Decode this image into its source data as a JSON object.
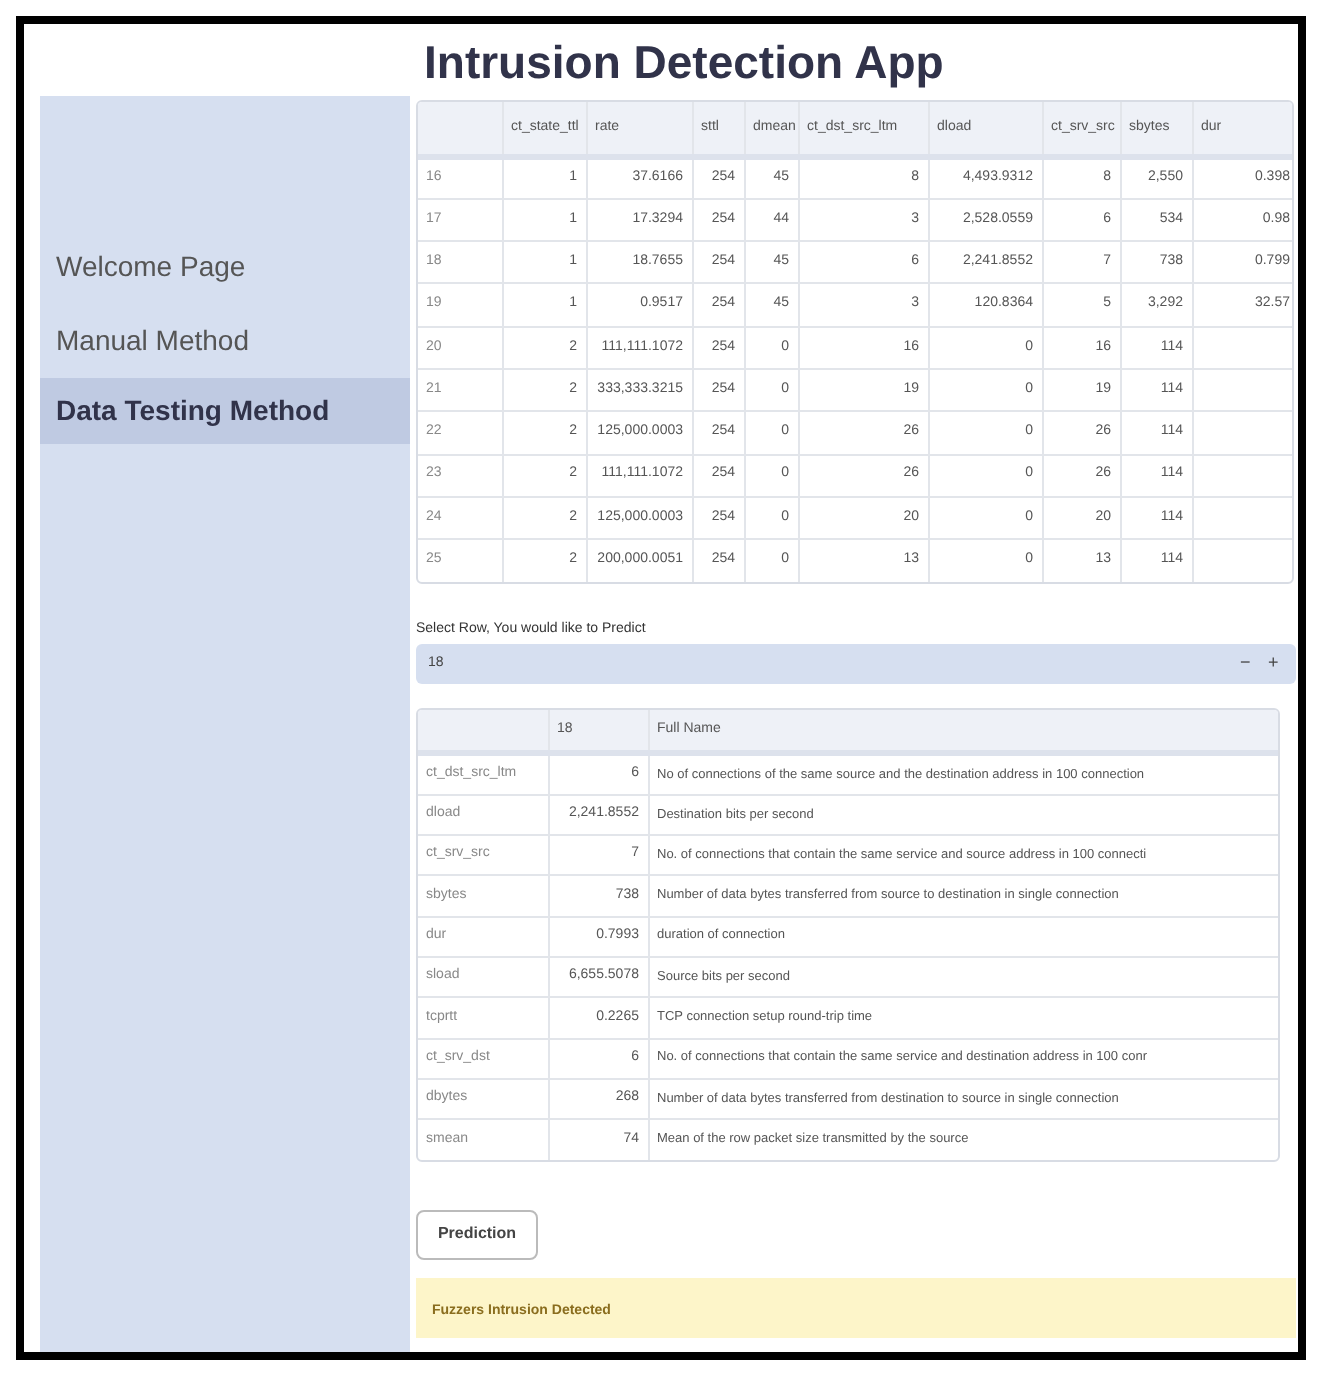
{
  "title": "Intrusion Detection App",
  "sidebar": {
    "items": [
      {
        "label": "Welcome Page",
        "selected": false
      },
      {
        "label": "Manual Method",
        "selected": false
      },
      {
        "label": "Data Testing Method",
        "selected": true
      }
    ]
  },
  "data_table": {
    "columns": [
      "ct_state_ttl",
      "rate",
      "sttl",
      "dmean",
      "ct_dst_src_ltm",
      "dload",
      "ct_srv_src",
      "sbytes",
      "dur"
    ],
    "rows": [
      {
        "index": "16",
        "cells": [
          "1",
          "37.6166",
          "254",
          "45",
          "8",
          "4,493.9312",
          "8",
          "2,550",
          "0.398"
        ]
      },
      {
        "index": "17",
        "cells": [
          "1",
          "17.3294",
          "254",
          "44",
          "3",
          "2,528.0559",
          "6",
          "534",
          "0.98"
        ]
      },
      {
        "index": "18",
        "cells": [
          "1",
          "18.7655",
          "254",
          "45",
          "6",
          "2,241.8552",
          "7",
          "738",
          "0.799"
        ]
      },
      {
        "index": "19",
        "cells": [
          "1",
          "0.9517",
          "254",
          "45",
          "3",
          "120.8364",
          "5",
          "3,292",
          "32.57"
        ]
      },
      {
        "index": "20",
        "cells": [
          "2",
          "111,111.1072",
          "254",
          "0",
          "16",
          "0",
          "16",
          "114"
        ]
      },
      {
        "index": "21",
        "cells": [
          "2",
          "333,333.3215",
          "254",
          "0",
          "19",
          "0",
          "19",
          "114"
        ]
      },
      {
        "index": "22",
        "cells": [
          "2",
          "125,000.0003",
          "254",
          "0",
          "26",
          "0",
          "26",
          "114"
        ]
      },
      {
        "index": "23",
        "cells": [
          "2",
          "111,111.1072",
          "254",
          "0",
          "26",
          "0",
          "26",
          "114"
        ]
      },
      {
        "index": "24",
        "cells": [
          "2",
          "125,000.0003",
          "254",
          "0",
          "20",
          "0",
          "20",
          "114"
        ]
      },
      {
        "index": "25",
        "cells": [
          "2",
          "200,000.0051",
          "254",
          "0",
          "13",
          "0",
          "13",
          "114"
        ]
      }
    ]
  },
  "row_select": {
    "label": "Select Row, You would like to Predict",
    "value": "18",
    "decrement": "−",
    "increment": "+"
  },
  "detail_table": {
    "columns": [
      "18",
      "Full Name"
    ],
    "rows": [
      {
        "feature": "ct_dst_src_ltm",
        "value": "6",
        "full_name": "No of connections of the same source and the destination address in 100 connection"
      },
      {
        "feature": "dload",
        "value": "2,241.8552",
        "full_name": "Destination bits per second"
      },
      {
        "feature": "ct_srv_src",
        "value": "7",
        "full_name": "No. of connections that contain the same service and source address in 100 connecti"
      },
      {
        "feature": "sbytes",
        "value": "738",
        "full_name": "Number of data bytes transferred from source to destination in single connection"
      },
      {
        "feature": "dur",
        "value": "0.7993",
        "full_name": "duration of connection"
      },
      {
        "feature": "sload",
        "value": "6,655.5078",
        "full_name": "Source bits per second"
      },
      {
        "feature": "tcprtt",
        "value": "0.2265",
        "full_name": "TCP connection setup round-trip time"
      },
      {
        "feature": "ct_srv_dst",
        "value": "6",
        "full_name": "No. of connections that contain the same service and destination address in 100 conr"
      },
      {
        "feature": "dbytes",
        "value": "268",
        "full_name": "Number of data bytes transferred from destination to source in single connection"
      },
      {
        "feature": "smean",
        "value": "74",
        "full_name": "Mean of the row packet size transmitted by the source"
      }
    ]
  },
  "predict_button": "Prediction",
  "result": "Fuzzers Intrusion Detected"
}
